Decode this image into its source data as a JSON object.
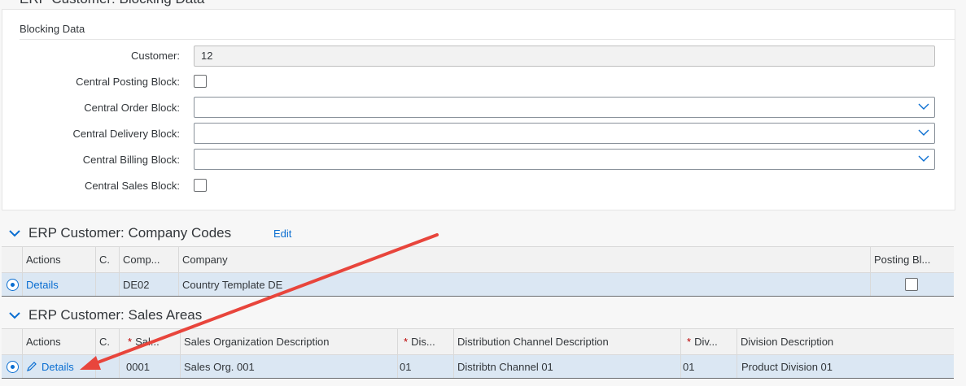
{
  "top_section_title": "ERP Customer: Blocking Data",
  "blocking": {
    "title": "Blocking Data",
    "customer_label": "Customer:",
    "customer_value": "12",
    "posting_label": "Central Posting Block:",
    "order_label": "Central Order Block:",
    "delivery_label": "Central Delivery Block:",
    "billing_label": "Central Billing Block:",
    "sales_label": "Central Sales Block:"
  },
  "company_codes": {
    "title": "ERP Customer: Company Codes",
    "edit_label": "Edit",
    "headers": {
      "actions": "Actions",
      "c": "C.",
      "comp": "Comp...",
      "company": "Company",
      "posting": "Posting Bl..."
    },
    "row": {
      "action": "Details",
      "comp": "DE02",
      "company": "Country Template DE"
    }
  },
  "sales_areas": {
    "title": "ERP Customer: Sales Areas",
    "headers": {
      "actions": "Actions",
      "c": "C.",
      "sales": "Sal...",
      "sales_desc": "Sales Organization Description",
      "dis": "Dis...",
      "dis_desc": "Distribution Channel Description",
      "div": "Div...",
      "div_desc": "Division Description"
    },
    "row": {
      "action": "Details",
      "sales": "0001",
      "sales_desc": "Sales Org. 001",
      "dis": "01",
      "dis_desc": "Distribtn Channel 01",
      "div": "01",
      "div_desc": "Product Division 01"
    }
  },
  "colors": {
    "link": "#0a6ed1",
    "selected_row": "#dbe7f3",
    "arrow": "#e8453c",
    "required": "#bb0000"
  }
}
